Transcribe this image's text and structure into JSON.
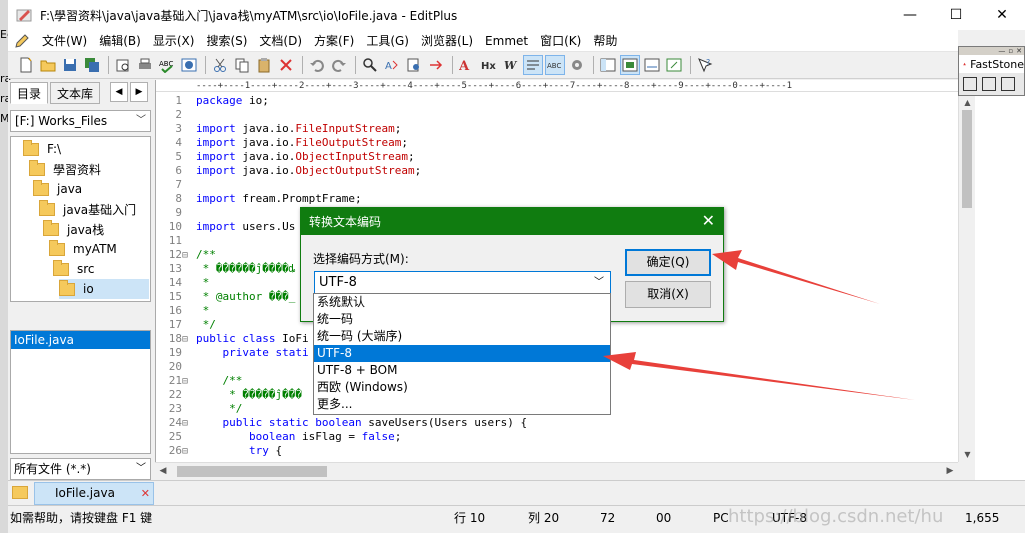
{
  "window": {
    "title": "F:\\學習资料\\java\\java基础入门\\java栈\\myATM\\src\\io\\IoFile.java - EditPlus",
    "controls": [
      "—",
      "☐",
      "✕"
    ]
  },
  "outer_strip": [
    "Ec",
    "ra",
    "ra",
    "M"
  ],
  "menu": [
    "文件(W)",
    "编辑(B)",
    "显示(X)",
    "搜索(S)",
    "文档(D)",
    "方案(F)",
    "工具(G)",
    "浏览器(L)",
    "Emmet",
    "窗口(K)",
    "帮助"
  ],
  "faststone": {
    "title": "FastStone"
  },
  "left_panel": {
    "tabs": [
      "目录",
      "文本库"
    ],
    "drive": "[F:] Works_Files",
    "tree": [
      {
        "label": "F:\\",
        "level": 0
      },
      {
        "label": "學習资料",
        "level": 1
      },
      {
        "label": "java",
        "level": 2
      },
      {
        "label": "java基础入门",
        "level": 3
      },
      {
        "label": "java栈",
        "level": 4
      },
      {
        "label": "myATM",
        "level": 5
      },
      {
        "label": "src",
        "level": 6
      },
      {
        "label": "io",
        "level": 7
      }
    ],
    "files": [
      "IoFile.java"
    ],
    "filter": "所有文件 (*.*)"
  },
  "editor": {
    "ruler": "----+----1----+----2----+----3----+----4----+----5----+----6----+----7----+----8----+----9----+----0----+----1",
    "lines": [
      {
        "n": "1",
        "fold": "",
        "parts": [
          [
            "kw",
            "package"
          ],
          [
            "tx",
            " io;"
          ]
        ]
      },
      {
        "n": "2",
        "fold": "",
        "parts": []
      },
      {
        "n": "3",
        "fold": "",
        "parts": [
          [
            "kw",
            "import"
          ],
          [
            "tx",
            " java.io."
          ],
          [
            "cls",
            "FileInputStream"
          ],
          [
            "tx",
            ";"
          ]
        ]
      },
      {
        "n": "4",
        "fold": "",
        "parts": [
          [
            "kw",
            "import"
          ],
          [
            "tx",
            " java.io."
          ],
          [
            "cls",
            "FileOutputStream"
          ],
          [
            "tx",
            ";"
          ]
        ]
      },
      {
        "n": "5",
        "fold": "",
        "parts": [
          [
            "kw",
            "import"
          ],
          [
            "tx",
            " java.io."
          ],
          [
            "cls",
            "ObjectInputStream"
          ],
          [
            "tx",
            ";"
          ]
        ]
      },
      {
        "n": "6",
        "fold": "",
        "parts": [
          [
            "kw",
            "import"
          ],
          [
            "tx",
            " java.io."
          ],
          [
            "cls",
            "ObjectOutputStream"
          ],
          [
            "tx",
            ";"
          ]
        ]
      },
      {
        "n": "7",
        "fold": "",
        "parts": []
      },
      {
        "n": "8",
        "fold": "",
        "parts": [
          [
            "kw",
            "import"
          ],
          [
            "tx",
            " fream.PromptFrame;"
          ]
        ]
      },
      {
        "n": "9",
        "fold": "",
        "parts": []
      },
      {
        "n": "10",
        "fold": "",
        "parts": [
          [
            "kw",
            "import"
          ],
          [
            "tx",
            " users.Us"
          ]
        ]
      },
      {
        "n": "11",
        "fold": "",
        "parts": []
      },
      {
        "n": "12",
        "fold": "⊟",
        "parts": [
          [
            "cm",
            "/**"
          ]
        ]
      },
      {
        "n": "13",
        "fold": "",
        "parts": [
          [
            "cm",
            " * ������ĵ����ȡ"
          ]
        ]
      },
      {
        "n": "14",
        "fold": "",
        "parts": [
          [
            "cm",
            " *"
          ]
        ]
      },
      {
        "n": "15",
        "fold": "",
        "parts": [
          [
            "cm",
            " * @author ���_"
          ]
        ]
      },
      {
        "n": "16",
        "fold": "",
        "parts": [
          [
            "cm",
            " *"
          ]
        ]
      },
      {
        "n": "17",
        "fold": "",
        "parts": [
          [
            "cm",
            " */"
          ]
        ]
      },
      {
        "n": "18",
        "fold": "⊟",
        "parts": [
          [
            "kw",
            "public"
          ],
          [
            "tx",
            " "
          ],
          [
            "kw",
            "class"
          ],
          [
            "tx",
            " IoFi"
          ]
        ]
      },
      {
        "n": "19",
        "fold": "",
        "parts": [
          [
            "tx",
            "    "
          ],
          [
            "kw",
            "private"
          ],
          [
            "tx",
            " "
          ],
          [
            "kw",
            "stati"
          ]
        ]
      },
      {
        "n": "20",
        "fold": "",
        "parts": []
      },
      {
        "n": "21",
        "fold": "⊟",
        "parts": [
          [
            "cm",
            "    /**"
          ]
        ]
      },
      {
        "n": "22",
        "fold": "",
        "parts": [
          [
            "cm",
            "     * �����ĵ���"
          ]
        ]
      },
      {
        "n": "23",
        "fold": "",
        "parts": [
          [
            "cm",
            "     */"
          ]
        ]
      },
      {
        "n": "24",
        "fold": "⊟",
        "parts": [
          [
            "tx",
            "    "
          ],
          [
            "kw",
            "public"
          ],
          [
            "tx",
            " "
          ],
          [
            "kw",
            "static"
          ],
          [
            "tx",
            " "
          ],
          [
            "kw",
            "boolean"
          ],
          [
            "tx",
            " saveUsers(Users users) {"
          ]
        ]
      },
      {
        "n": "25",
        "fold": "",
        "parts": [
          [
            "tx",
            "        "
          ],
          [
            "kw",
            "boolean"
          ],
          [
            "tx",
            " isFlag = "
          ],
          [
            "kw",
            "false"
          ],
          [
            "tx",
            ";"
          ]
        ]
      },
      {
        "n": "26",
        "fold": "⊟",
        "parts": [
          [
            "tx",
            "        "
          ],
          [
            "kw",
            "try"
          ],
          [
            "tx",
            " {"
          ]
        ]
      }
    ]
  },
  "doc_tab": "IoFile.java",
  "status": {
    "help": "如需帮助，请按键盘 F1 键",
    "line": "行 10",
    "col": "列 20",
    "v72": "72",
    "v00": "00",
    "pc": "PC",
    "encoding": "UTF-8",
    "size": "1,655",
    "watermark": "https://blog.csdn.net/hu"
  },
  "dialog": {
    "title": "转换文本编码",
    "label": "选择编码方式(M):",
    "selected": "UTF-8",
    "ok": "确定(Q)",
    "cancel": "取消(X)",
    "options": [
      "系统默认",
      "统一码",
      "统一码 (大端序)",
      "UTF-8",
      "UTF-8 + BOM",
      "西欧 (Windows)",
      "更多..."
    ],
    "selected_index": 3
  },
  "colors": {
    "dialog_title": "#107c10",
    "selection": "#0078d7",
    "arrow": "#e8403a",
    "keyword": "#0000ff",
    "class_name": "#c00000",
    "comment": "#008000"
  }
}
